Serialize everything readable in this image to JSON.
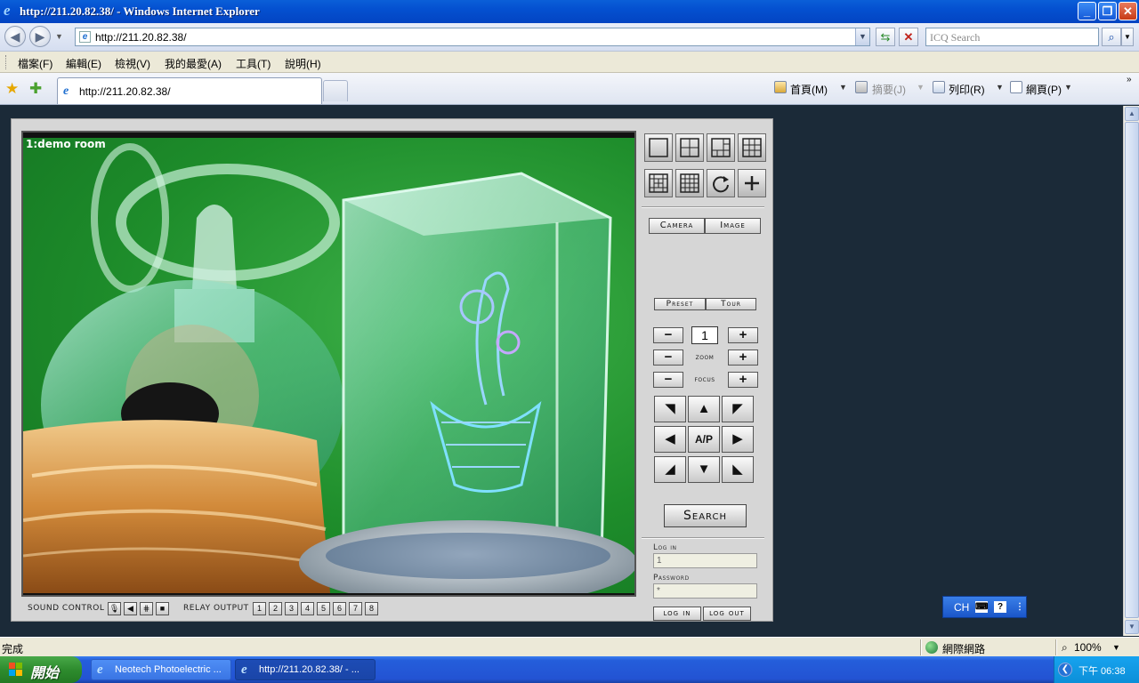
{
  "window": {
    "title": "http://211.20.82.38/ - Windows Internet Explorer",
    "min_glyph": "_",
    "max_glyph": "❐",
    "close_glyph": "✕"
  },
  "address_bar": {
    "url": "http://211.20.82.38/",
    "search_placeholder": "ICQ Search"
  },
  "menu": {
    "items": [
      "檔案(F)",
      "編輯(E)",
      "檢視(V)",
      "我的最愛(A)",
      "工具(T)",
      "說明(H)"
    ]
  },
  "tabs": {
    "active_tab": "http://211.20.82.38/"
  },
  "command_bar": {
    "home": "首頁(M)",
    "feeds": "摘要(J)",
    "print": "列印(R)",
    "page": "網頁(P)"
  },
  "dvr": {
    "camera_label": "1:demo room",
    "sound_control_label": "SOUND CONTROL",
    "relay_output_label": "RELAY OUTPUT",
    "relays": [
      "1",
      "2",
      "3",
      "4",
      "5",
      "6",
      "7",
      "8"
    ],
    "camera_button": "Camera",
    "image_button": "Image",
    "preset_button": "Preset",
    "tour_button": "Tour",
    "preset_value": "1",
    "zoom_label": "zoom",
    "focus_label": "focus",
    "minus": "−",
    "plus": "+",
    "ap_label": "A/P",
    "search_button": "Search",
    "login_label": "Log in",
    "password_label": "Password",
    "login_value": "1",
    "password_value": "*",
    "login_button": "log in",
    "logout_button": "log out"
  },
  "language_bar": {
    "lang": "CH"
  },
  "status_bar": {
    "status": "完成",
    "zone": "網際網路",
    "zoom": "100%"
  },
  "taskbar": {
    "start": "開始",
    "items": [
      {
        "label": "Neotech Photoelectric ..."
      },
      {
        "label": "http://211.20.82.38/ - ..."
      }
    ],
    "clock": "下午 06:38"
  }
}
